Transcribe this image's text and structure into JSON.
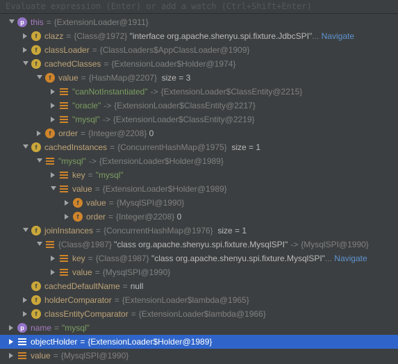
{
  "hint": "Evaluate expression (Enter) or add a watch (Ctrl+Shift+Enter)",
  "n": {
    "this": "this",
    "clazz": "clazz",
    "classLoader": "classLoader",
    "cachedClasses": "cachedClasses",
    "value": "value",
    "order": "order",
    "cachedInstances": "cachedInstances",
    "key": "key",
    "joinInstances": "joinInstances",
    "cachedDefaultName": "cachedDefaultName",
    "holderComparator": "holderComparator",
    "classEntityComparator": "classEntityComparator",
    "name": "name",
    "objectHolder": "objectHolder",
    "canNotInstantiated": "\"canNotInstantiated\"",
    "oracle": "\"oracle\"",
    "mysql": "\"mysql\""
  },
  "v": {
    "this": "{ExtensionLoader@1911}",
    "clazz_g": "{Class@1972}",
    "clazz_t": "\"interface org.apache.shenyu.spi.fixture.JdbcSPI\"",
    "classLoader": "{ClassLoaders$AppClassLoader@1909}",
    "cachedClasses": "{ExtensionLoader$Holder@1974}",
    "hashmap": "{HashMap@2207}",
    "size3": "size = 3",
    "ce2215": "{ExtensionLoader$ClassEntity@2215}",
    "ce2217": "{ExtensionLoader$ClassEntity@2217}",
    "ce2219": "{ExtensionLoader$ClassEntity@2219}",
    "int2208": "{Integer@2208}",
    "zero": "0",
    "cachedInstances": "{ConcurrentHashMap@1975}",
    "size1": "size = 1",
    "holder1989": "{ExtensionLoader$Holder@1989}",
    "mysqlstr": "\"mysql\"",
    "mysqlspi1990": "{MysqlSPI@1990}",
    "joinInstances": "{ConcurrentHashMap@1976}",
    "class1987": "{Class@1987}",
    "classMysqlSPI": "\"class org.apache.shenyu.spi.fixture.MysqlSPI\"",
    "null": "null",
    "lambda1965": "{ExtensionLoader$lambda@1965}",
    "lambda1966": "{ExtensionLoader$lambda@1966}",
    "ellipsis": "...",
    "navigate": "Navigate",
    "arrow": "->"
  }
}
